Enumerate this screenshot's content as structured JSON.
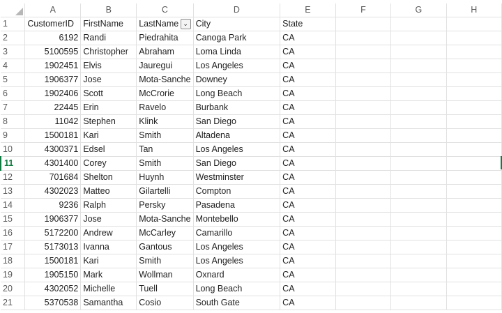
{
  "columns": [
    "A",
    "B",
    "C",
    "D",
    "E",
    "F",
    "G",
    "H"
  ],
  "active_row": "11",
  "rows": [
    {
      "n": "1",
      "a": "CustomerID",
      "b": "FirstName",
      "c": "LastName",
      "d": "City",
      "e": "State"
    },
    {
      "n": "2",
      "a": "6192",
      "b": "Randi",
      "c": "Piedrahita",
      "d": "Canoga Park",
      "e": "CA"
    },
    {
      "n": "3",
      "a": "5100595",
      "b": "Christopher",
      "c": "Abraham",
      "d": "Loma Linda",
      "e": "CA"
    },
    {
      "n": "4",
      "a": "1902451",
      "b": "Elvis",
      "c": "Jauregui",
      "d": "Los Angeles",
      "e": "CA"
    },
    {
      "n": "5",
      "a": "1906377",
      "b": "Jose",
      "c": "Mota-Sanche",
      "d": "Downey",
      "e": "CA"
    },
    {
      "n": "6",
      "a": "1902406",
      "b": "Scott",
      "c": "McCrorie",
      "d": "Long Beach",
      "e": "CA"
    },
    {
      "n": "7",
      "a": "22445",
      "b": "Erin",
      "c": "Ravelo",
      "d": "Burbank",
      "e": "CA"
    },
    {
      "n": "8",
      "a": "11042",
      "b": "Stephen",
      "c": "Klink",
      "d": "San Diego",
      "e": "CA"
    },
    {
      "n": "9",
      "a": "1500181",
      "b": "Kari",
      "c": "Smith",
      "d": "Altadena",
      "e": "CA"
    },
    {
      "n": "10",
      "a": "4300371",
      "b": "Edsel",
      "c": "Tan",
      "d": "Los Angeles",
      "e": "CA"
    },
    {
      "n": "11",
      "a": "4301400",
      "b": "Corey",
      "c": "Smith",
      "d": "San Diego",
      "e": "CA"
    },
    {
      "n": "12",
      "a": "701684",
      "b": "Shelton",
      "c": "Huynh",
      "d": "Westminster",
      "e": "CA"
    },
    {
      "n": "13",
      "a": "4302023",
      "b": "Matteo",
      "c": "Gilartelli",
      "d": "Compton",
      "e": "CA"
    },
    {
      "n": "14",
      "a": "9236",
      "b": "Ralph",
      "c": "Persky",
      "d": "Pasadena",
      "e": "CA"
    },
    {
      "n": "15",
      "a": "1906377",
      "b": "Jose",
      "c": "Mota-Sanche",
      "d": "Montebello",
      "e": "CA"
    },
    {
      "n": "16",
      "a": "5172200",
      "b": "Andrew",
      "c": "McCarley",
      "d": "Camarillo",
      "e": "CA"
    },
    {
      "n": "17",
      "a": "5173013",
      "b": "Ivanna",
      "c": "Gantous",
      "d": "Los Angeles",
      "e": "CA"
    },
    {
      "n": "18",
      "a": "1500181",
      "b": "Kari",
      "c": "Smith",
      "d": "Los Angeles",
      "e": "CA"
    },
    {
      "n": "19",
      "a": "1905150",
      "b": "Mark",
      "c": "Wollman",
      "d": "Oxnard",
      "e": "CA"
    },
    {
      "n": "20",
      "a": "4302052",
      "b": "Michelle",
      "c": "Tuell",
      "d": "Long Beach",
      "e": "CA"
    },
    {
      "n": "21",
      "a": "5370538",
      "b": "Samantha",
      "c": "Cosio",
      "d": "South Gate",
      "e": "CA"
    }
  ],
  "filter_icon": "chevron-down-icon",
  "accent_color": "#107c41"
}
